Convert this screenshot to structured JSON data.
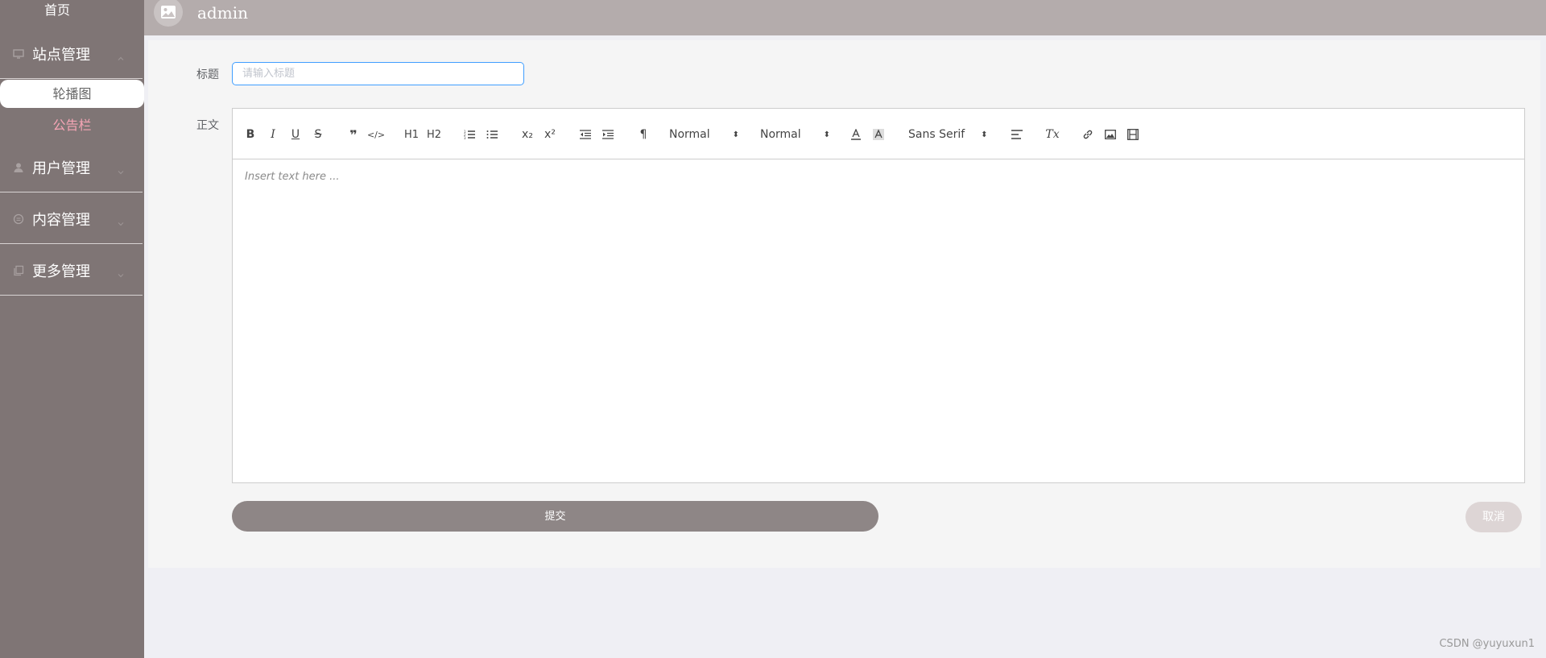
{
  "sidebar": {
    "home": "首页",
    "site_management": "站点管理",
    "carousel": "轮播图",
    "notice_board": "公告栏",
    "user_management": "用户管理",
    "content_management": "内容管理",
    "more_management": "更多管理"
  },
  "header": {
    "user": "admin"
  },
  "form": {
    "title_label": "标题",
    "title_placeholder": "请输入标题",
    "body_label": "正文",
    "editor_placeholder": "Insert text here ...",
    "submit_label": "提交",
    "cancel_label": "取消"
  },
  "toolbar": {
    "header_select": "Normal",
    "size_select": "Normal",
    "font_select": "Sans Serif",
    "buttons": [
      "B",
      "I",
      "U",
      "S",
      "❞",
      "</>",
      "H1",
      "H2",
      "ol",
      "ul",
      "x₂",
      "x²",
      "outdent",
      "indent",
      "¶",
      "A",
      "A-bg",
      "align",
      "Tx",
      "link",
      "image",
      "video"
    ]
  },
  "colors": {
    "sidebar": "#7f7575",
    "topbar": "#b4acac",
    "accent": "#409eff",
    "submit": "#8e8686"
  },
  "watermark": "CSDN @yuyuxun1"
}
